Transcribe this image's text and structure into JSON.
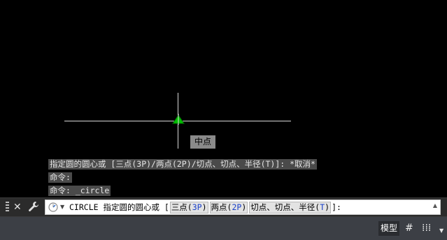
{
  "canvas": {
    "snap_tooltip": "中点"
  },
  "history": [
    "指定圆的圆心或 [三点(3P)/两点(2P)/切点、切点、半径(T)]: *取消*",
    "命令:",
    "命令: _circle"
  ],
  "command_line": {
    "prefix": "CIRCLE 指定圆的圆心或 [",
    "options": [
      {
        "label": "三点(",
        "key": "3P",
        "close": ")"
      },
      {
        "label": "两点(",
        "key": "2P",
        "close": ")"
      },
      {
        "label": "切点、切点、半径(",
        "key": "T",
        "close": ")"
      }
    ],
    "suffix": "]:"
  },
  "toolbar": {
    "close_glyph": "✕",
    "customize_glyph": "🔧"
  },
  "status_bar": {
    "model_label": "模型",
    "grid_glyph": "#",
    "snap_glyph": "⁞⁞⁞",
    "menu_glyph": "▼"
  },
  "colors": {
    "canvas_bg": "#000000",
    "crosshair": "#d9d9d9",
    "snap_marker": "#00c000",
    "option_key": "#1a40c8",
    "status_bg": "#3c3f45"
  }
}
